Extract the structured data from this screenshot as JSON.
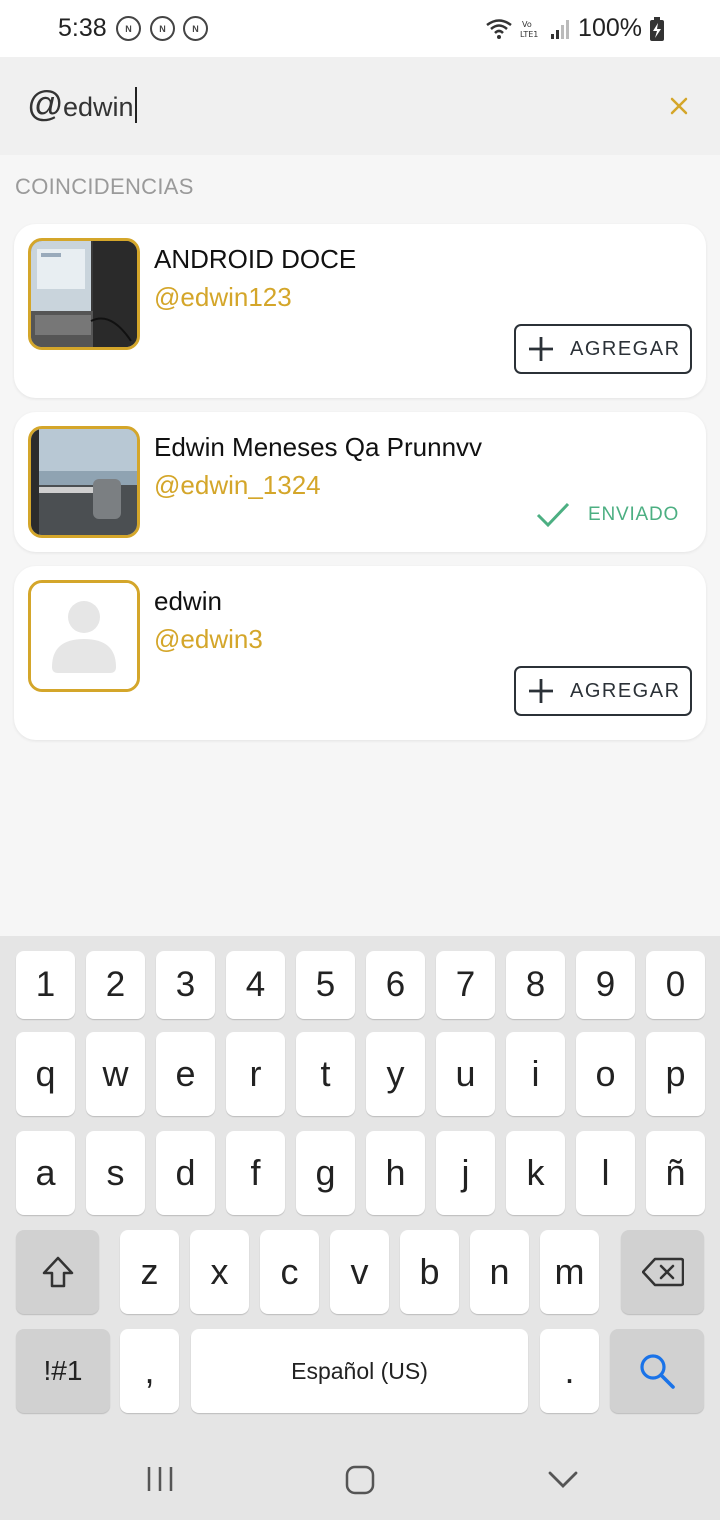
{
  "status_bar": {
    "time": "5:38",
    "notifications": [
      "N",
      "N",
      "N"
    ],
    "battery": "100%"
  },
  "search": {
    "prefix": "@",
    "value": "edwin"
  },
  "section_label": "COINCIDENCIAS",
  "results": [
    {
      "name": "ANDROID DOCE",
      "handle": "@edwin123",
      "action": "AGREGAR",
      "state": "add"
    },
    {
      "name": "Edwin Meneses Qa Prunnvv",
      "handle": "@edwin_1324",
      "action": "ENVIADO",
      "state": "sent"
    },
    {
      "name": "edwin",
      "handle": "@edwin3",
      "action": "AGREGAR",
      "state": "add"
    }
  ],
  "keyboard": {
    "row_numbers": [
      "1",
      "2",
      "3",
      "4",
      "5",
      "6",
      "7",
      "8",
      "9",
      "0"
    ],
    "row1": [
      "q",
      "w",
      "e",
      "r",
      "t",
      "y",
      "u",
      "i",
      "o",
      "p"
    ],
    "row2": [
      "a",
      "s",
      "d",
      "f",
      "g",
      "h",
      "j",
      "k",
      "l",
      "ñ"
    ],
    "row3": [
      "z",
      "x",
      "c",
      "v",
      "b",
      "n",
      "m"
    ],
    "symbols_key": "!#1",
    "comma_key": ",",
    "space_label": "Español (US)",
    "period_key": "."
  },
  "colors": {
    "accent": "#d4a62a",
    "sent_green": "#4caf82",
    "search_blue": "#1a73e8"
  }
}
